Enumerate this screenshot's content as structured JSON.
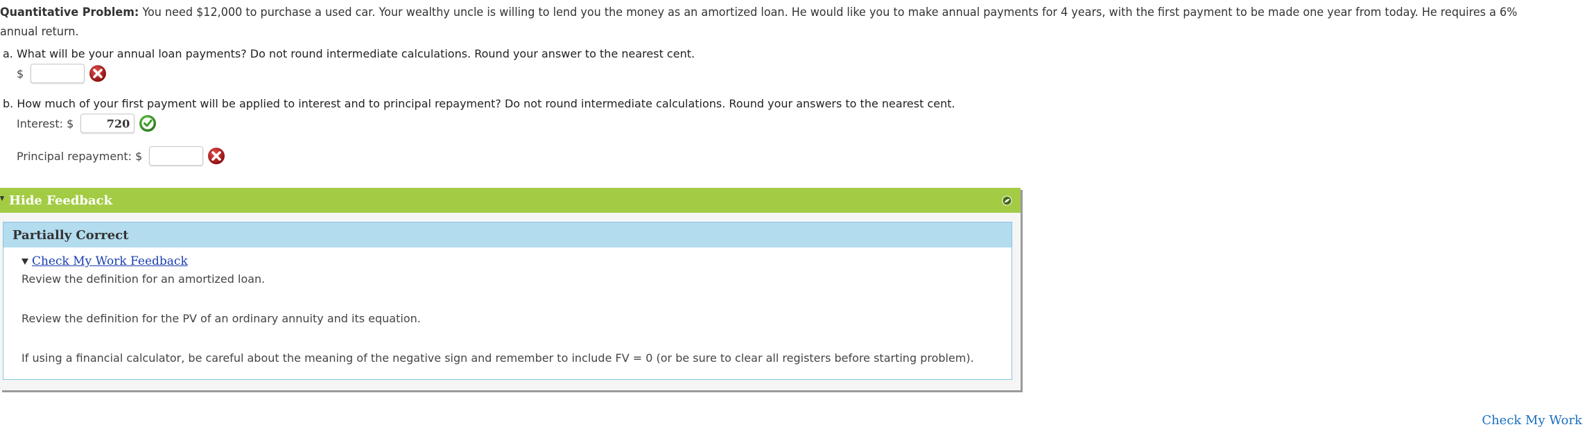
{
  "problem": {
    "label": "Quantitative Problem:",
    "text": " You need $12,000 to purchase a used car. Your wealthy uncle is willing to lend you the money as an amortized loan. He would like you to make annual payments for 4 years, with the first payment to be made one year from today. He requires a 6% annual return."
  },
  "question_a": {
    "text": "a. What will be your annual loan payments? Do not round intermediate calculations. Round your answer to the nearest cent.",
    "currency": "$",
    "value": "",
    "status": "incorrect"
  },
  "question_b": {
    "text": "b. How much of your first payment will be applied to interest and to principal repayment? Do not round intermediate calculations. Round your answers to the nearest cent.",
    "interest_label": "Interest: $",
    "interest_value": "720",
    "interest_status": "correct",
    "principal_label": "Principal repayment: $",
    "principal_value": "",
    "principal_status": "incorrect"
  },
  "feedback": {
    "toggle_label": "Hide Feedback",
    "status": "Partially Correct",
    "check_link": "Check My Work Feedback",
    "lines": [
      "Review the definition for an amortized loan.",
      "Review the definition for the PV of an ordinary annuity and its equation.",
      "If using a financial calculator, be careful about the meaning of the negative sign and remember to include FV = 0 (or be sure to clear all registers before starting problem)."
    ]
  },
  "footer": {
    "check_my_work": "Check My Work"
  },
  "colors": {
    "feedback_header": "#a3cc44",
    "status_bar": "#b3dcee",
    "link": "#1a3fb0",
    "correct": "#3a9a2a",
    "incorrect": "#b31b1b"
  }
}
